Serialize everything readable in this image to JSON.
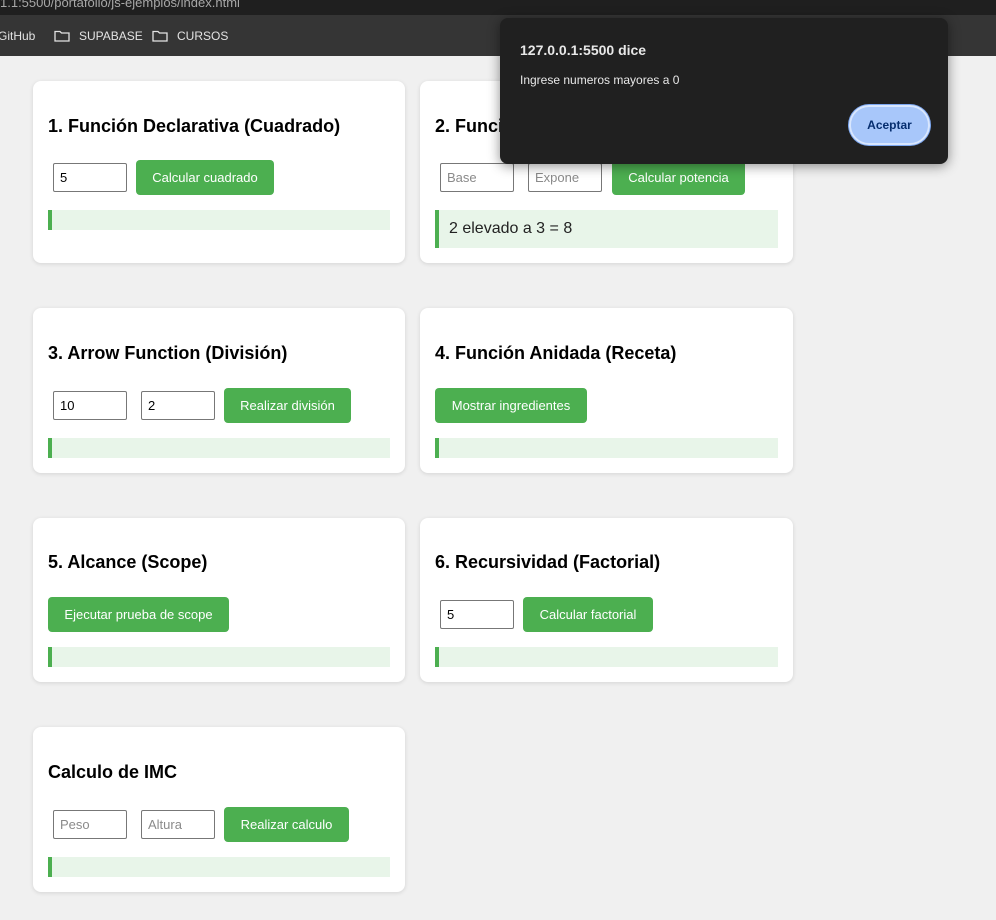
{
  "browser": {
    "url": "1.1:5500/portafolio/js-ejemplos/index.html",
    "bookmarks": [
      "GitHub",
      "SUPABASE",
      "CURSOS"
    ]
  },
  "cards": {
    "c1": {
      "title": "1. Función Declarativa (Cuadrado)",
      "input_value": "5",
      "button": "Calcular cuadrado",
      "result": ""
    },
    "c2": {
      "title": "2. Función Expresiva (Potencia)",
      "base_placeholder": "Base",
      "exp_placeholder": "Expone",
      "button": "Calcular potencia",
      "result": "2 elevado a 3 = 8"
    },
    "c3": {
      "title": "3. Arrow Function (División)",
      "input1_value": "10",
      "input2_value": "2",
      "button": "Realizar división",
      "result": ""
    },
    "c4": {
      "title": "4. Función Anidada (Receta)",
      "button": "Mostrar ingredientes",
      "result": ""
    },
    "c5": {
      "title": "5. Alcance (Scope)",
      "button": "Ejecutar prueba de scope",
      "result": ""
    },
    "c6": {
      "title": "6. Recursividad (Factorial)",
      "input_value": "5",
      "button": "Calcular factorial",
      "result": ""
    },
    "c7": {
      "title": "Calculo de IMC",
      "peso_placeholder": "Peso",
      "altura_placeholder": "Altura",
      "button": "Realizar calculo",
      "result": ""
    }
  },
  "dialog": {
    "title": "127.0.0.1:5500 dice",
    "message": "Ingrese numeros mayores a 0",
    "button": "Aceptar"
  },
  "colors": {
    "accent": "#4caf50",
    "result_bg": "#e8f5e9",
    "dialog_bg": "#202020",
    "dialog_button": "#a8c7fa"
  }
}
